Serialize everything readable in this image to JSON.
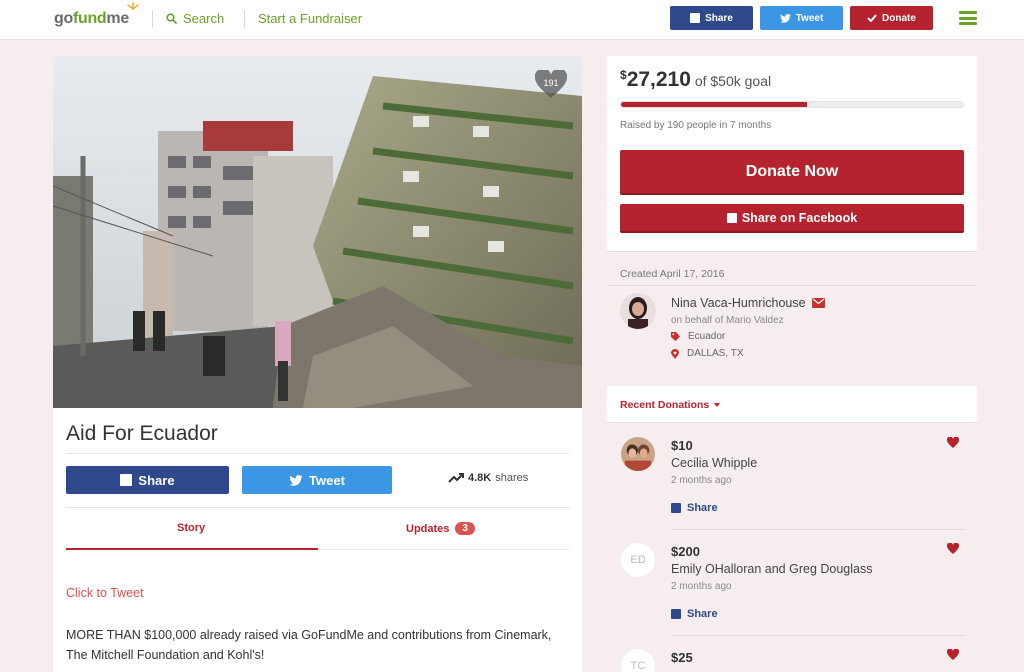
{
  "header": {
    "logo": {
      "go": "go",
      "fund": "fund",
      "me": "me"
    },
    "search_label": "Search",
    "start_label": "Start a Fundraiser",
    "share_label": "Share",
    "tweet_label": "Tweet",
    "donate_label": "Donate"
  },
  "campaign": {
    "hearts_count": "191",
    "title": "Aid For Ecuador",
    "share_label": "Share",
    "tweet_label": "Tweet",
    "shares_count": "4.8K",
    "shares_suffix": "shares",
    "tabs": {
      "story": "Story",
      "updates": "Updates",
      "updates_count": "3"
    },
    "click_to_tweet": "Click to Tweet",
    "story_text": "MORE THAN $100,000 already raised via GoFundMe and contributions from Cinemark, The Mitchell Foundation and Kohl's!"
  },
  "goal": {
    "currency": "$",
    "raised_amount": "27,210",
    "goal_text": "of $50k goal",
    "progress_fraction": 0.544,
    "raised_by": "Raised by 190 people in 7 months",
    "donate_now": "Donate Now",
    "share_facebook": "Share on Facebook"
  },
  "organizer": {
    "created": "Created April 17, 2016",
    "name": "Nina Vaca-Humrichouse",
    "behalf": "on behalf of Mario Valdez",
    "category": "Ecuador",
    "location": "DALLAS, TX"
  },
  "recent": {
    "label": "Recent Donations"
  },
  "donations": [
    {
      "amount": "$10",
      "name": "Cecilia Whipple",
      "ago": "2 months ago",
      "share": "Share",
      "initials": ""
    },
    {
      "amount": "$200",
      "name": "Emily OHalloran and Greg Douglass",
      "ago": "2 months ago",
      "share": "Share",
      "initials": "ED"
    },
    {
      "amount": "$25",
      "name": "",
      "ago": "",
      "share": "",
      "initials": "TC"
    }
  ],
  "colors": {
    "brand_green": "#6aa32a",
    "brand_red": "#b5232e",
    "facebook": "#2e4a8c",
    "twitter": "#3b97e3"
  }
}
